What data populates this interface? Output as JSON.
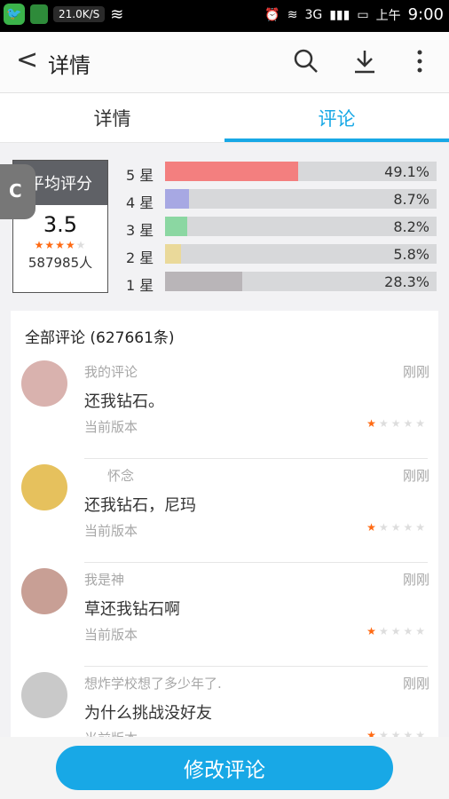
{
  "status": {
    "network_speed": "21.0K/S",
    "network_type": "3G",
    "ampm": "上午",
    "time": "9:00"
  },
  "header": {
    "title": "详情"
  },
  "tabs": [
    {
      "label": "详情",
      "active": false
    },
    {
      "label": "评论",
      "active": true
    }
  ],
  "rating": {
    "header": "平均评分",
    "score": "3.5",
    "count": "587985人",
    "distribution": [
      {
        "label": "5 星",
        "percent": "49.1%",
        "fraction": 0.491,
        "color": "#f37f7f"
      },
      {
        "label": "4 星",
        "percent": "8.7%",
        "fraction": 0.087,
        "color": "#a7a8e3"
      },
      {
        "label": "3 星",
        "percent": "8.2%",
        "fraction": 0.082,
        "color": "#8bd7a2"
      },
      {
        "label": "2 星",
        "percent": "5.8%",
        "fraction": 0.058,
        "color": "#ead99a"
      },
      {
        "label": "1 星",
        "percent": "28.3%",
        "fraction": 0.283,
        "color": "#b9b5b8"
      }
    ]
  },
  "reviews_header": "全部评论 (627661条)",
  "reviews": [
    {
      "name": "我的评论",
      "time": "刚刚",
      "text": "还我钻石。",
      "version": "当前版本",
      "stars": 1,
      "avatar_color": "#d9b2ae"
    },
    {
      "name": "怀念",
      "time": "刚刚",
      "text": "还我钻石，尼玛",
      "version": "当前版本",
      "stars": 1,
      "avatar_color": "#e6c15d"
    },
    {
      "name": "我是神",
      "time": "刚刚",
      "text": "草还我钻石啊",
      "version": "当前版本",
      "stars": 1,
      "avatar_color": "#c89f95"
    },
    {
      "name": "想炸学校想了多少年了.",
      "time": "刚刚",
      "text": "为什么挑战没好友",
      "version": "当前版本",
      "stars": 1,
      "avatar_color": "#c9c9c9"
    }
  ],
  "bottom_button": "修改评论",
  "colors": {
    "accent": "#18a8e6",
    "star": "#ff6a13"
  }
}
